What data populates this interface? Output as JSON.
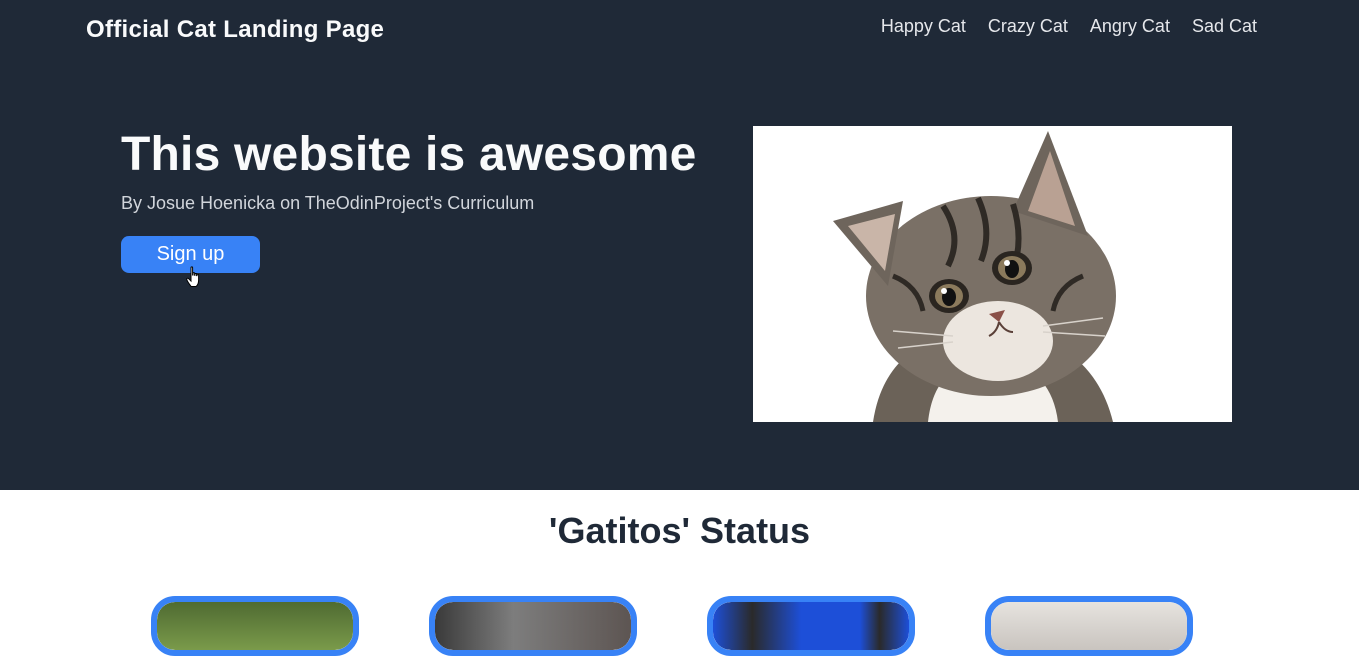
{
  "header": {
    "brand": "Official Cat Landing Page",
    "nav": [
      "Happy Cat",
      "Crazy Cat",
      "Angry Cat",
      "Sad Cat"
    ]
  },
  "hero": {
    "headline": "This website is awesome",
    "byline": "By Josue Hoenicka on TheOdinProject's Curriculum",
    "signup_label": "Sign up",
    "image_icon": "kitten-photo"
  },
  "status": {
    "title": "'Gatitos' Status",
    "cards": [
      {
        "icon": "cat-photo-green-background"
      },
      {
        "icon": "cat-photo-gray"
      },
      {
        "icon": "cat-photo-blue-background"
      },
      {
        "icon": "cat-photo-white"
      }
    ]
  },
  "colors": {
    "hero_bg": "#1f2937",
    "accent": "#3882f6",
    "text_light": "#f9fafb",
    "text_muted": "#d1d5db"
  }
}
